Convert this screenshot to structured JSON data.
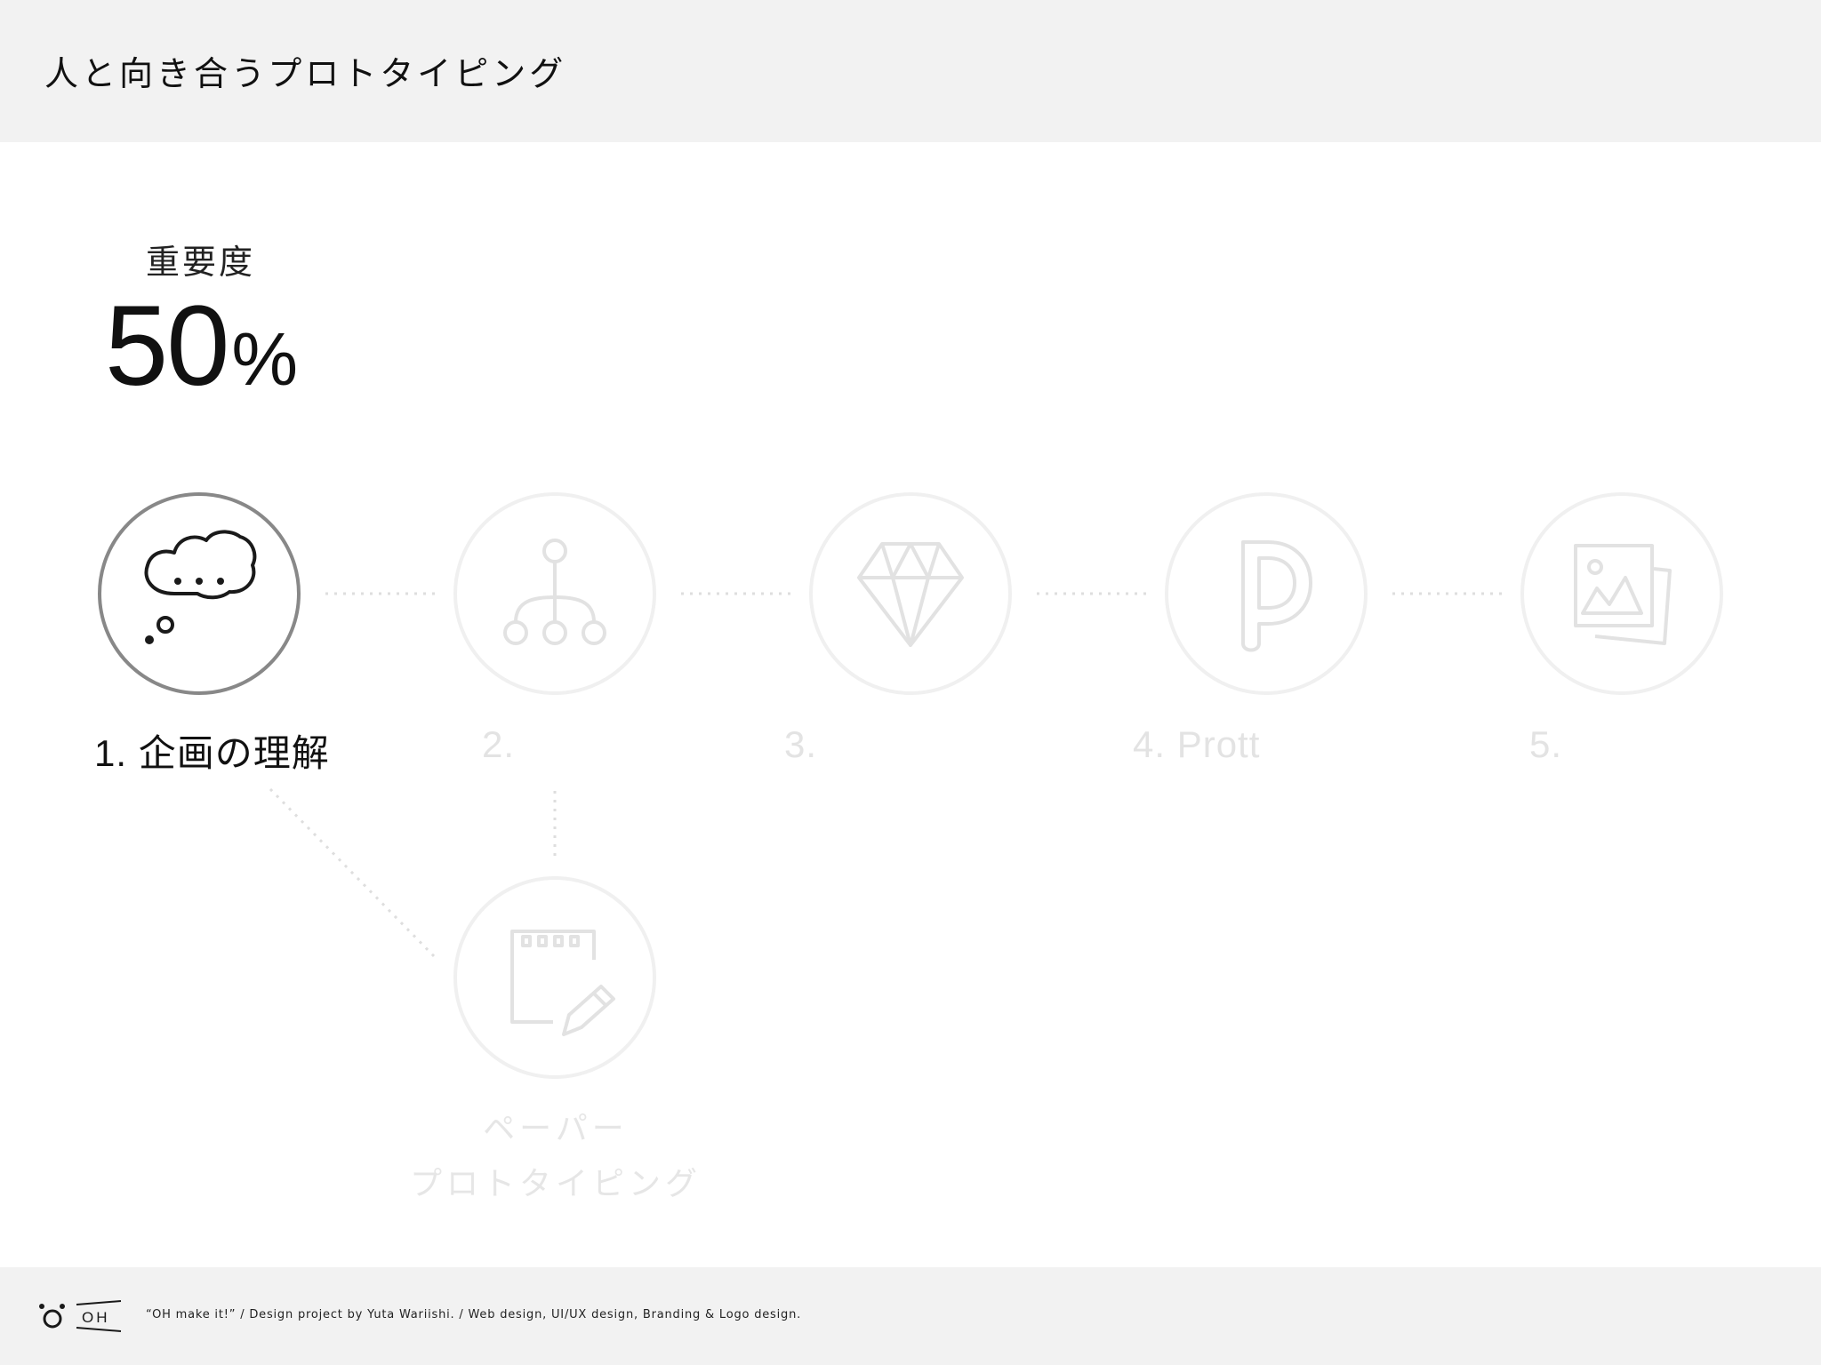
{
  "header": {
    "title": "人と向き合うプロトタイピング"
  },
  "importance": {
    "label": "重要度",
    "value": "50",
    "unit": "%"
  },
  "steps": [
    {
      "label": "1. 企画の理解",
      "icon": "thought-bubble-icon",
      "active": true
    },
    {
      "label": "2.",
      "icon": "sitemap-icon",
      "active": false
    },
    {
      "label": "3.",
      "icon": "diamond-icon",
      "active": false
    },
    {
      "label": "4. Prott",
      "icon": "prott-logo-icon",
      "active": false
    },
    {
      "label": "5.",
      "icon": "image-gallery-icon",
      "active": false
    }
  ],
  "sub_step": {
    "icon": "notepad-pencil-icon",
    "label_line1": "ペーパー",
    "label_line2": "プロトタイピング"
  },
  "footer": {
    "logo_text": "OH",
    "credit": "“OH make it!”  /  Design project by Yuta Wariishi.  /  Web design, UI/UX design, Branding & Logo design."
  },
  "colors": {
    "header_bg": "#f2f2f2",
    "footer_bg": "#f2f2f2",
    "active_ring": "#888888",
    "inactive_ring": "#f0f0f0",
    "inactive_icon": "#e2e2e2"
  }
}
